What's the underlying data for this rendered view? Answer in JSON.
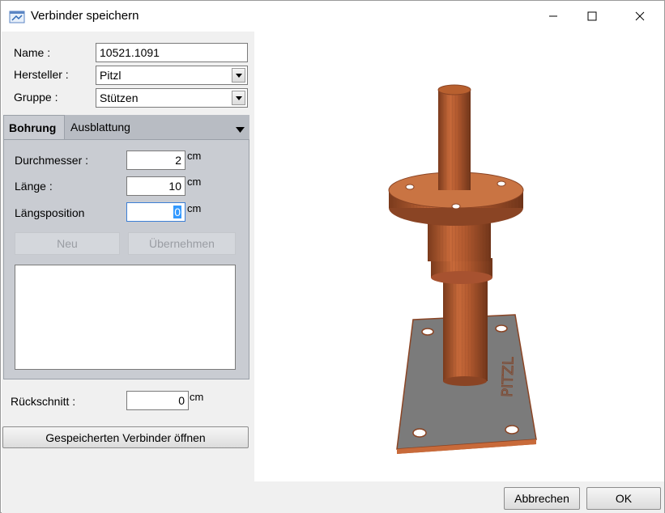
{
  "window": {
    "title": "Verbinder speichern",
    "icon": "app-icon",
    "controls": [
      "minimize-icon",
      "maximize-icon",
      "close-icon"
    ]
  },
  "form": {
    "name_label": "Name :",
    "name_value": "10521.1091",
    "hersteller_label": "Hersteller :",
    "hersteller_value": "Pitzl",
    "gruppe_label": "Gruppe :",
    "gruppe_value": "Stützen"
  },
  "tabs": {
    "active": "Bohrung",
    "other": "Ausblattung"
  },
  "bohrung": {
    "durchmesser_label": "Durchmesser :",
    "durchmesser_value": "2",
    "laenge_label": "Länge :",
    "laenge_value": "10",
    "laengsposition_label": "Längsposition",
    "laengsposition_value": "0",
    "unit": "cm",
    "neu_label": "Neu",
    "uebernehmen_label": "Übernehmen"
  },
  "rueckschnitt": {
    "label": "Rückschnitt :",
    "value": "0",
    "unit": "cm"
  },
  "buttons": {
    "open_saved": "Gespeicherten Verbinder öffnen",
    "cancel": "Abbrechen",
    "ok": "OK"
  },
  "model": {
    "plate_text": "PITZL",
    "colors": {
      "metal": "#c86a3a",
      "metal_dark": "#8a4424",
      "plate": "#7a7a7a"
    }
  }
}
